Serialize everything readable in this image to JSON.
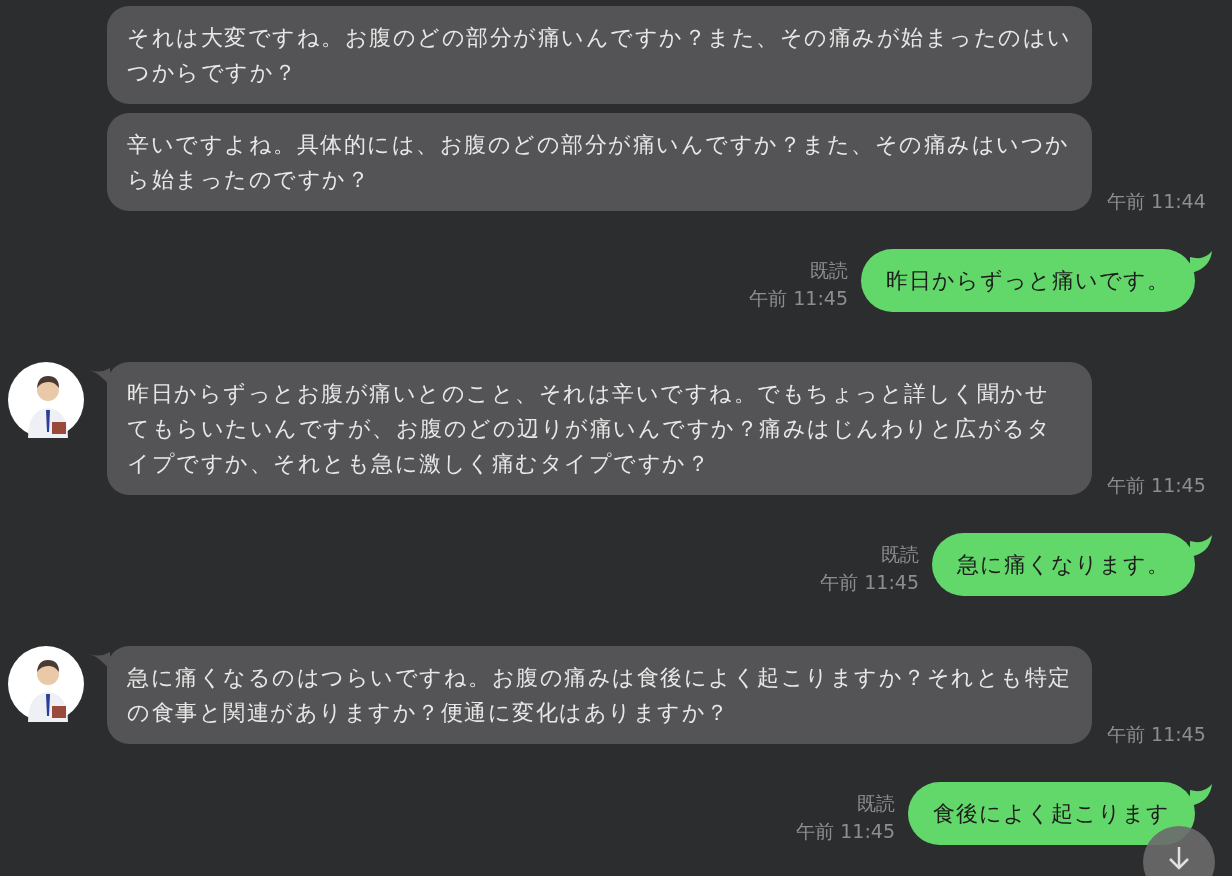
{
  "messages": [
    {
      "kind": "incoming",
      "avatar": false,
      "text": "それは大変ですね。お腹のどの部分が痛いんですか？また、その痛みが始まったのはいつからですか？"
    },
    {
      "kind": "incoming",
      "avatar": false,
      "text": "辛いですよね。具体的には、お腹のどの部分が痛いんですか？また、その痛みはいつから始まったのですか？",
      "time": "午前 11:44"
    },
    {
      "kind": "outgoing",
      "read": "既読",
      "time": "午前 11:45",
      "text": "昨日からずっと痛いです。"
    },
    {
      "kind": "incoming",
      "avatar": true,
      "text": "昨日からずっとお腹が痛いとのこと、それは辛いですね。でもちょっと詳しく聞かせてもらいたいんですが、お腹のどの辺りが痛いんですか？痛みはじんわりと広がるタイプですか、それとも急に激しく痛むタイプですか？",
      "time": "午前 11:45"
    },
    {
      "kind": "outgoing",
      "read": "既読",
      "time": "午前 11:45",
      "text": "急に痛くなります。"
    },
    {
      "kind": "incoming",
      "avatar": true,
      "text": "急に痛くなるのはつらいですね。お腹の痛みは食後によく起こりますか？それとも特定の食事と関連がありますか？便通に変化はありますか？",
      "time": "午前 11:45"
    },
    {
      "kind": "outgoing",
      "read": "既読",
      "time": "午前 11:45",
      "text": "食後によく起こります"
    }
  ]
}
